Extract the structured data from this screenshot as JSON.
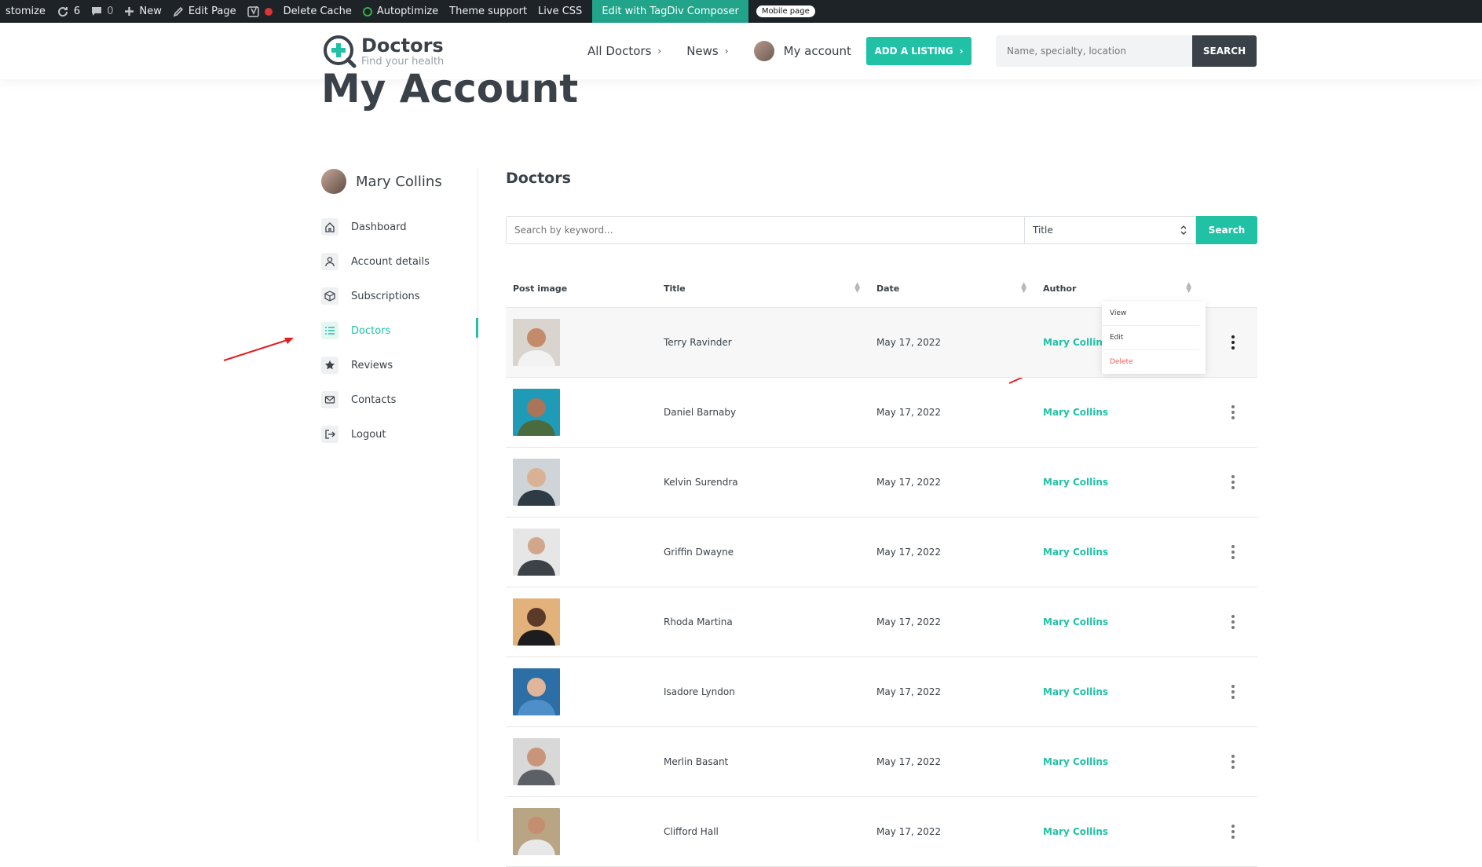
{
  "adminbar": {
    "customize": "stomize",
    "updates_count": "6",
    "comments_count": "0",
    "new": "New",
    "edit_page": "Edit Page",
    "delete_cache": "Delete Cache",
    "autoptimize": "Autoptimize",
    "theme_support": "Theme support",
    "live_css": "Live CSS",
    "tagdiv": "Edit with TagDiv Composer",
    "mobile_page": "Mobile page"
  },
  "header": {
    "logo_title": "Doctors",
    "logo_tagline": "Find your health",
    "nav": [
      "All Doctors",
      "News",
      "My account"
    ],
    "add_listing": "ADD A LISTING",
    "search_placeholder": "Name, specialty, location",
    "search_button": "SEARCH"
  },
  "page_title": "My Account",
  "sidebar": {
    "user_name": "Mary Collins",
    "items": [
      {
        "label": "Dashboard",
        "icon": "home-icon"
      },
      {
        "label": "Account details",
        "icon": "user-icon"
      },
      {
        "label": "Subscriptions",
        "icon": "box-icon"
      },
      {
        "label": "Doctors",
        "icon": "list-icon",
        "active": true
      },
      {
        "label": "Reviews",
        "icon": "star-icon"
      },
      {
        "label": "Contacts",
        "icon": "mail-icon"
      },
      {
        "label": "Logout",
        "icon": "logout-icon"
      }
    ]
  },
  "main": {
    "section_title": "Doctors",
    "keyword_placeholder": "Search by keyword...",
    "select_value": "Title",
    "search_button": "Search",
    "columns": [
      "Post image",
      "Title",
      "Date",
      "Author"
    ],
    "rows": [
      {
        "title": "Terry Ravinder",
        "date": "May 17, 2022",
        "author": "Mary Collins"
      },
      {
        "title": "Daniel Barnaby",
        "date": "May 17, 2022",
        "author": "Mary Collins"
      },
      {
        "title": "Kelvin Surendra",
        "date": "May 17, 2022",
        "author": "Mary Collins"
      },
      {
        "title": "Griffin Dwayne",
        "date": "May 17, 2022",
        "author": "Mary Collins"
      },
      {
        "title": "Rhoda Martina",
        "date": "May 17, 2022",
        "author": "Mary Collins"
      },
      {
        "title": "Isadore Lyndon",
        "date": "May 17, 2022",
        "author": "Mary Collins"
      },
      {
        "title": "Merlin Basant",
        "date": "May 17, 2022",
        "author": "Mary Collins"
      },
      {
        "title": "Clifford Hall",
        "date": "May 17, 2022",
        "author": "Mary Collins"
      }
    ],
    "dropdown": [
      "View",
      "Edit",
      "Delete"
    ]
  },
  "colors": {
    "accent": "#21c1a6",
    "admin_bar": "#1d2327",
    "danger": "#f05a5a"
  }
}
